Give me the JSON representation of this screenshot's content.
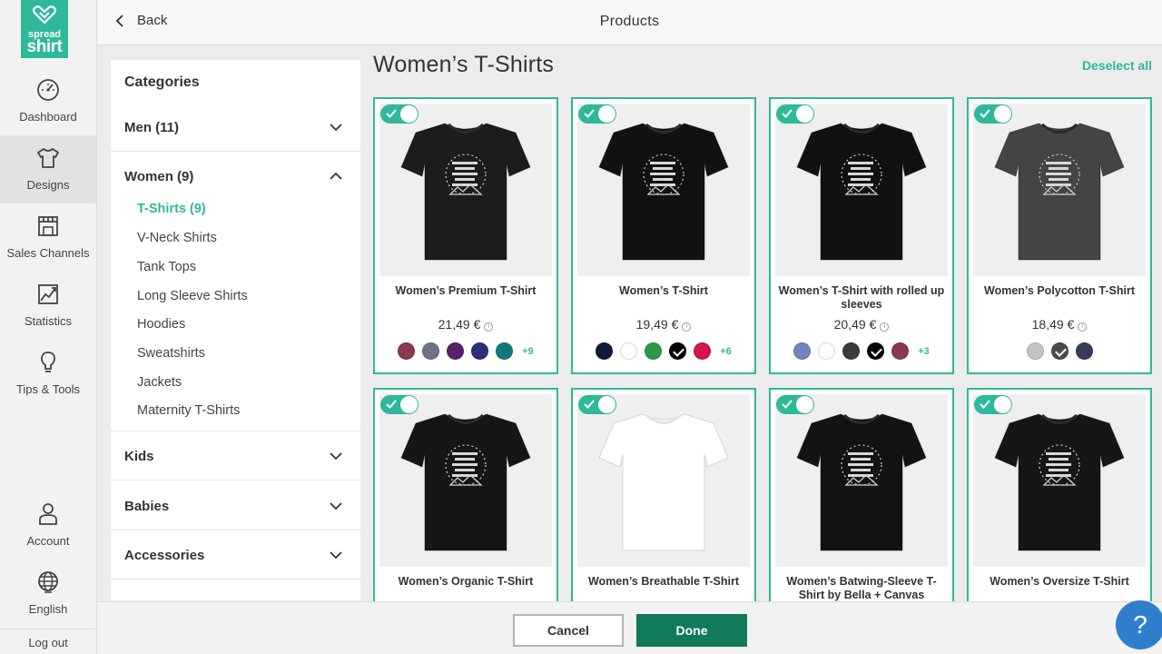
{
  "logo": {
    "line1": "spread",
    "line2": "shirt"
  },
  "nav": {
    "items": [
      {
        "label": "Dashboard",
        "icon": "gauge-icon"
      },
      {
        "label": "Designs",
        "icon": "tshirt-icon"
      },
      {
        "label": "Sales Channels",
        "icon": "store-icon"
      },
      {
        "label": "Statistics",
        "icon": "chart-icon"
      },
      {
        "label": "Tips & Tools",
        "icon": "lightbulb-icon"
      }
    ],
    "account": "Account",
    "language": "English",
    "logout": "Log out"
  },
  "topbar": {
    "back": "Back",
    "title": "Products"
  },
  "categories": {
    "title": "Categories",
    "groups": [
      {
        "label": "Men (11)"
      },
      {
        "label": "Women (9)"
      },
      {
        "label": "Kids"
      },
      {
        "label": "Babies"
      },
      {
        "label": "Accessories"
      }
    ],
    "women_sub": [
      "T-Shirts (9)",
      "V-Neck Shirts",
      "Tank Tops",
      "Long Sleeve Shirts",
      "Hoodies",
      "Sweatshirts",
      "Jackets",
      "Maternity T-Shirts"
    ]
  },
  "main": {
    "heading": "Women’s T-Shirts",
    "deselect": "Deselect all",
    "products": [
      {
        "name": "Women’s Premium T-Shirt",
        "price": "21,49 €",
        "more": "+9",
        "shirt_color": "#1c1c1c",
        "swatches": [
          "#8a3a4e",
          "#6e7289",
          "#5a2166",
          "#2d2e7a",
          "#117a78"
        ],
        "selected": -1
      },
      {
        "name": "Women’s T-Shirt",
        "price": "19,49 €",
        "more": "+6",
        "shirt_color": "#111111",
        "swatches": [
          "#101a3a",
          "#ffffff",
          "#2a9a47",
          "#000000",
          "#d3134a"
        ],
        "selected": 3
      },
      {
        "name": "Women’s T-Shirt with rolled up sleeves",
        "price": "20,49 €",
        "more": "+3",
        "shirt_color": "#111111",
        "swatches": [
          "#6f86b7",
          "#ffffff",
          "#3b3b3b",
          "#000000",
          "#8a3a4e"
        ],
        "selected": 3
      },
      {
        "name": "Women’s Polycotton T-Shirt",
        "price": "18,49 €",
        "more": "",
        "shirt_color": "#444444",
        "swatches": [
          "#c4c4c4",
          "#4a4a4a",
          "#363b56"
        ],
        "selected": 1
      },
      {
        "name": "Women’s Organic T-Shirt",
        "shirt_color": "#161616"
      },
      {
        "name": "Women’s Breathable T-Shirt",
        "shirt_color": "#ffffff"
      },
      {
        "name": "Women’s Batwing-Sleeve T-Shirt by Bella + Canvas",
        "shirt_color": "#131313"
      },
      {
        "name": "Women’s Oversize T-Shirt",
        "shirt_color": "#161616"
      }
    ]
  },
  "buttons": {
    "cancel": "Cancel",
    "done": "Done"
  },
  "help": "?",
  "colors": {
    "accent": "#2fb89a",
    "done": "#117a5a",
    "help": "#2f7fcd"
  }
}
